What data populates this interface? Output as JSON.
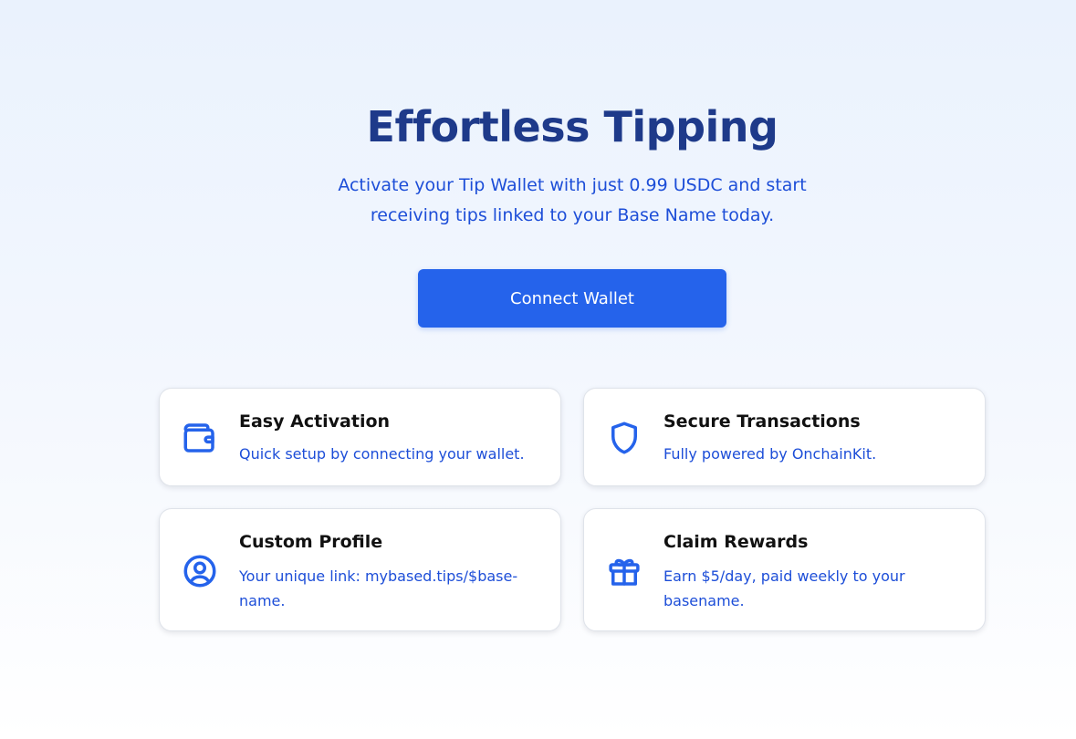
{
  "hero": {
    "title": "Effortless Tipping",
    "subtitle": "Activate your Tip Wallet with just 0.99 USDC and start receiving tips linked to your Base Name today."
  },
  "connect_button": {
    "label": "Connect Wallet"
  },
  "features": [
    {
      "icon": "wallet-icon",
      "title": "Easy Activation",
      "description": "Quick setup by connecting your wallet."
    },
    {
      "icon": "shield-icon",
      "title": "Secure Transactions",
      "description": "Fully powered by OnchainKit."
    },
    {
      "icon": "user-circle-icon",
      "title": "Custom Profile",
      "description": "Your unique link: mybased.tips/$base-name."
    },
    {
      "icon": "gift-icon",
      "title": "Claim Rewards",
      "description": "Earn $5/day, paid weekly to your basename."
    }
  ],
  "colors": {
    "title": "#1e3a8a",
    "accent": "#2563eb",
    "link_text": "#1d4ed8"
  }
}
